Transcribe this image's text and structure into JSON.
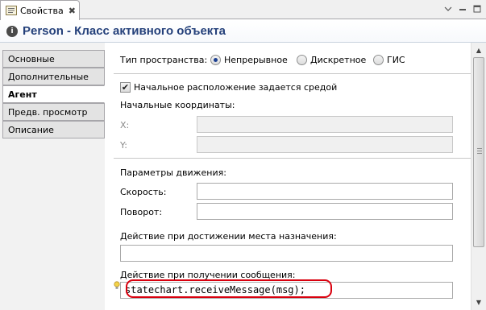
{
  "tab": {
    "label": "Свойства",
    "icon": "properties-icon",
    "close_icon": "close-icon"
  },
  "view_controls": {
    "minimize_icon": "view-menu-triangle-icon",
    "maximize_icon": "minimize-icon"
  },
  "title": {
    "icon": "info-icon",
    "text": "Person - Класс активного объекта"
  },
  "sections": [
    {
      "label": "Основные",
      "active": false
    },
    {
      "label": "Дополнительные",
      "active": false
    },
    {
      "label": "Агент",
      "active": true
    },
    {
      "label": "Предв. просмотр",
      "active": false
    },
    {
      "label": "Описание",
      "active": false
    }
  ],
  "space_type": {
    "label": "Тип пространства:",
    "options": [
      {
        "label": "Непрерывное",
        "selected": true
      },
      {
        "label": "Дискретное",
        "selected": false
      },
      {
        "label": "ГИС",
        "selected": false
      }
    ]
  },
  "initial_location": {
    "label": "Начальное расположение задается средой",
    "checked": true
  },
  "initial_coords": {
    "label": "Начальные координаты:",
    "x_label": "X:",
    "y_label": "Y:",
    "x_value": "",
    "y_value": ""
  },
  "movement": {
    "label": "Параметры движения:",
    "speed_label": "Скорость:",
    "rotation_label": "Поворот:",
    "speed_value": "",
    "rotation_value": ""
  },
  "on_arrival": {
    "label": "Действие при достижении места назначения:",
    "value": ""
  },
  "on_message": {
    "label": "Действие при получении сообщения:",
    "value": "statechart.receiveMessage(msg);",
    "hint_icon": "lightbulb-icon"
  },
  "colors": {
    "title": "#24407a",
    "highlight_ring": "#d9000e",
    "radio_dot": "#1b3f91"
  }
}
